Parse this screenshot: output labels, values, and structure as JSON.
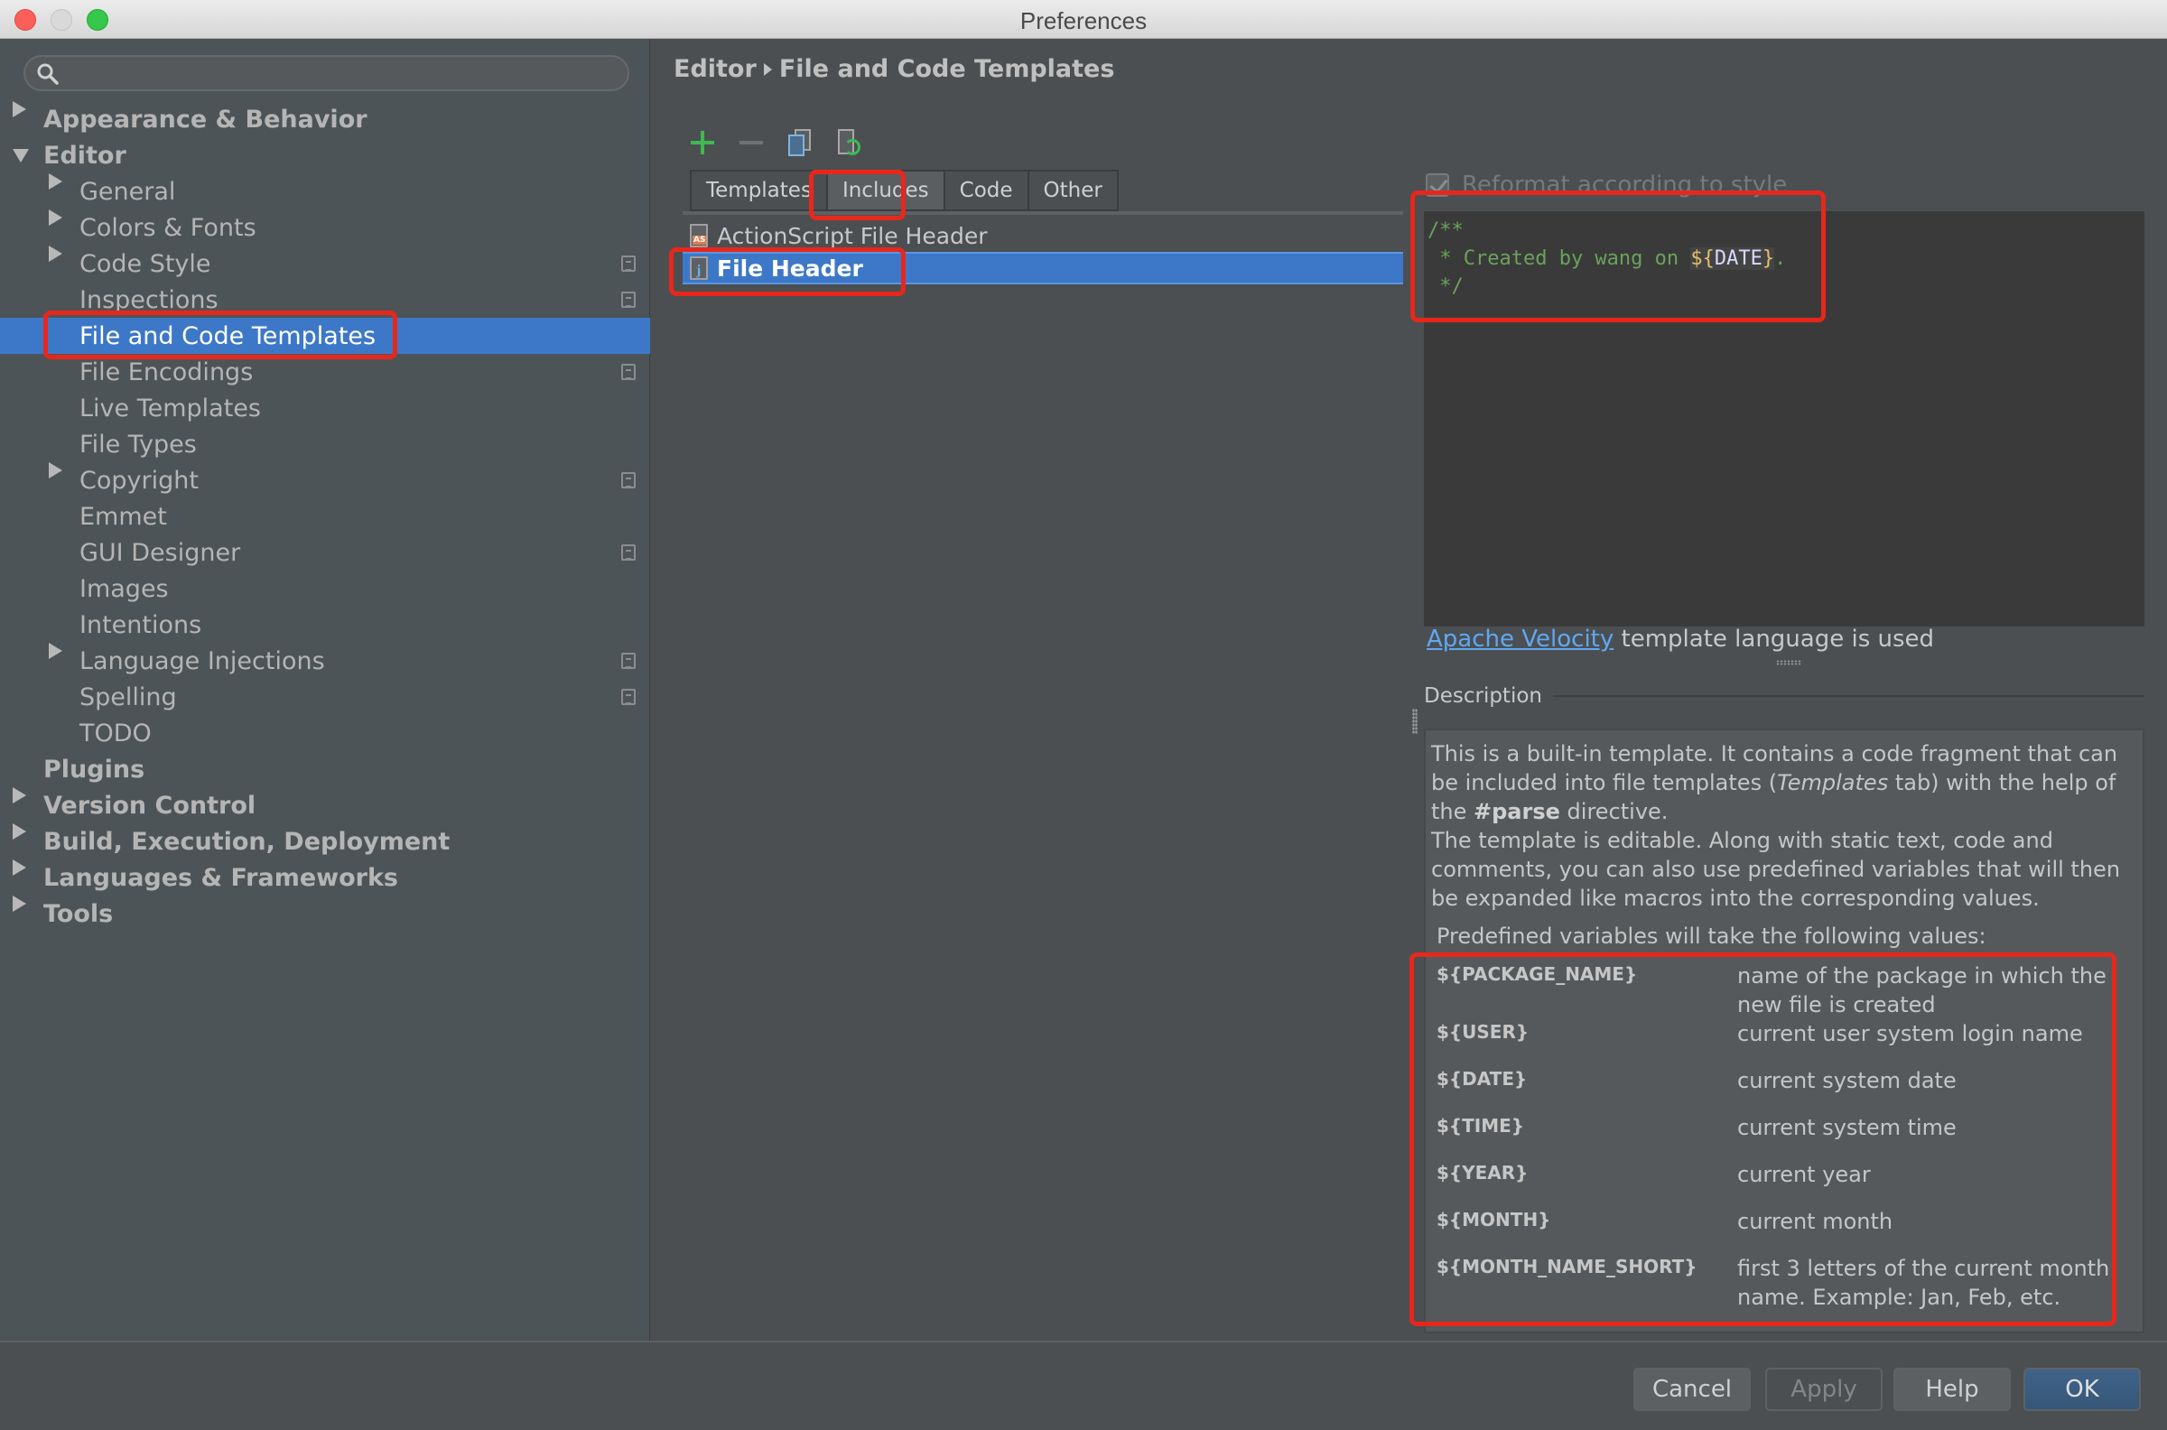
{
  "window": {
    "title": "Preferences"
  },
  "sidebar": {
    "search_placeholder": "",
    "items": [
      {
        "label": "Appearance & Behavior",
        "level": 0,
        "arrow": "right",
        "project": false
      },
      {
        "label": "Editor",
        "level": 0,
        "arrow": "down",
        "project": false
      },
      {
        "label": "General",
        "level": 1,
        "arrow": "right",
        "project": false
      },
      {
        "label": "Colors & Fonts",
        "level": 1,
        "arrow": "right",
        "project": false
      },
      {
        "label": "Code Style",
        "level": 1,
        "arrow": "right",
        "project": true
      },
      {
        "label": "Inspections",
        "level": 1,
        "arrow": "",
        "project": true
      },
      {
        "label": "File and Code Templates",
        "level": 1,
        "arrow": "",
        "project": false,
        "selected": true
      },
      {
        "label": "File Encodings",
        "level": 1,
        "arrow": "",
        "project": true
      },
      {
        "label": "Live Templates",
        "level": 1,
        "arrow": "",
        "project": false
      },
      {
        "label": "File Types",
        "level": 1,
        "arrow": "",
        "project": false
      },
      {
        "label": "Copyright",
        "level": 1,
        "arrow": "right",
        "project": true
      },
      {
        "label": "Emmet",
        "level": 1,
        "arrow": "",
        "project": false
      },
      {
        "label": "GUI Designer",
        "level": 1,
        "arrow": "",
        "project": true
      },
      {
        "label": "Images",
        "level": 1,
        "arrow": "",
        "project": false
      },
      {
        "label": "Intentions",
        "level": 1,
        "arrow": "",
        "project": false
      },
      {
        "label": "Language Injections",
        "level": 1,
        "arrow": "right",
        "project": true
      },
      {
        "label": "Spelling",
        "level": 1,
        "arrow": "",
        "project": true
      },
      {
        "label": "TODO",
        "level": 1,
        "arrow": "",
        "project": false
      },
      {
        "label": "Plugins",
        "level": 0,
        "arrow": "",
        "project": false
      },
      {
        "label": "Version Control",
        "level": 0,
        "arrow": "right",
        "project": false
      },
      {
        "label": "Build, Execution, Deployment",
        "level": 0,
        "arrow": "right",
        "project": false
      },
      {
        "label": "Languages & Frameworks",
        "level": 0,
        "arrow": "right",
        "project": false
      },
      {
        "label": "Tools",
        "level": 0,
        "arrow": "right",
        "project": false
      }
    ]
  },
  "breadcrumb": {
    "parent": "Editor",
    "current": "File and Code Templates"
  },
  "toolbar": {
    "add_icon": "plus-icon",
    "remove_icon": "minus-icon",
    "copy_icon": "copy-icon",
    "reset_icon": "reset-icon"
  },
  "tabs": [
    {
      "label": "Templates",
      "active": false
    },
    {
      "label": "Includes",
      "active": true
    },
    {
      "label": "Code",
      "active": false
    },
    {
      "label": "Other",
      "active": false
    }
  ],
  "template_list": [
    {
      "label": "ActionScript File Header",
      "icon": "AS",
      "selected": false
    },
    {
      "label": "File Header",
      "icon": "j",
      "selected": true
    }
  ],
  "right_panel": {
    "reformat_label": "Reformat according to style",
    "reformat_checked": true,
    "editor": {
      "line1": "/**",
      "line2_prefix": " * Created by wang on ",
      "var_open": "${",
      "var_name": "DATE",
      "var_close": "}",
      "line2_suffix": ".",
      "line3": " */"
    },
    "velocity_link": "Apache Velocity",
    "velocity_text": " template language is used",
    "description_label": "Description",
    "description": {
      "p1_a": "This is a built-in template. It contains a code fragment that can be included into file templates (",
      "p1_italic": "Templates",
      "p1_b": " tab) with the help of the ",
      "p1_bold": "#parse",
      "p1_c": " directive.",
      "p2": "The template is editable. Along with static text, code and comments, you can also use predefined variables that will then be expanded like macros into the corresponding values.",
      "predefined_intro": "Predefined variables will take the following values:"
    },
    "variables": [
      {
        "name": "${PACKAGE_NAME}",
        "desc": "name of the package in which the new file is created"
      },
      {
        "name": "${USER}",
        "desc": "current user system login name"
      },
      {
        "name": "${DATE}",
        "desc": "current system date"
      },
      {
        "name": "${TIME}",
        "desc": "current system time"
      },
      {
        "name": "${YEAR}",
        "desc": "current year"
      },
      {
        "name": "${MONTH}",
        "desc": "current month"
      },
      {
        "name": "${MONTH_NAME_SHORT}",
        "desc": "first 3 letters of the current month name. Example: Jan, Feb, etc."
      }
    ]
  },
  "footer": {
    "cancel": "Cancel",
    "apply": "Apply",
    "help": "Help",
    "ok": "OK"
  },
  "colors": {
    "selection": "#3d78c8",
    "highlight": "#e8271c",
    "link": "#5fa8f0",
    "ok_button": "#3f6389"
  }
}
